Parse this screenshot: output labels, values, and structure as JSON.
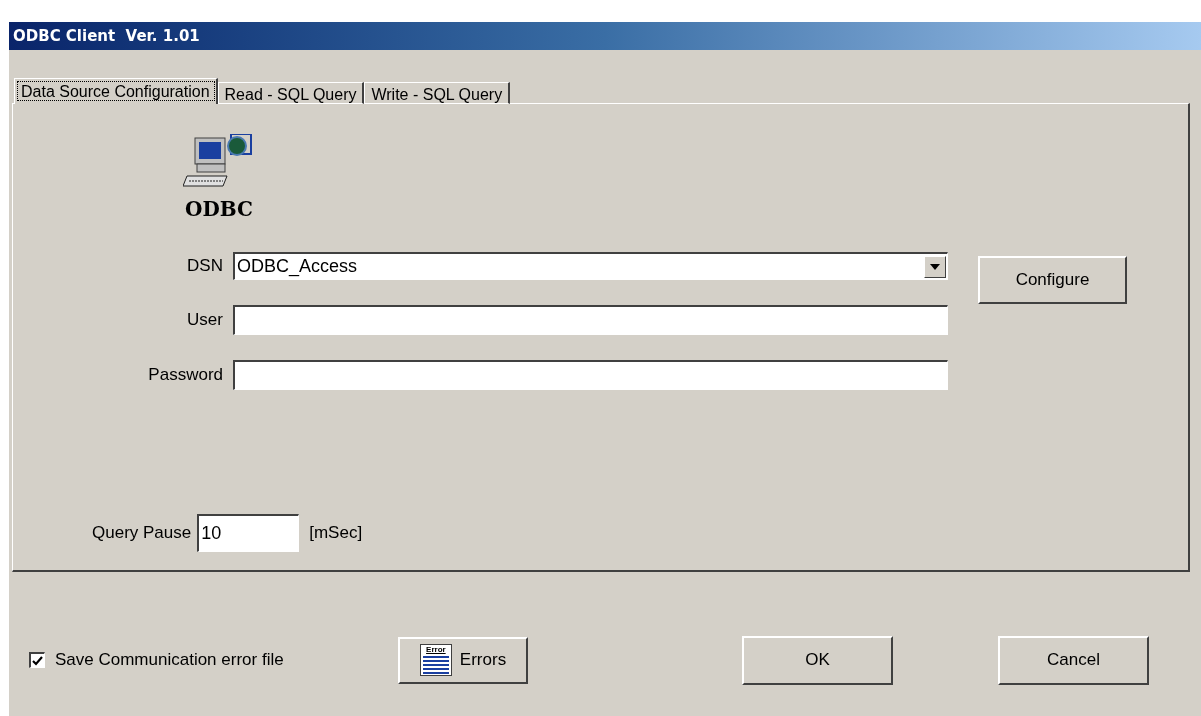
{
  "window": {
    "title": "ODBC Client  Ver. 1.01"
  },
  "tabs": [
    {
      "label": "Data Source Configuration",
      "selected": true
    },
    {
      "label": "Read - SQL Query",
      "selected": false
    },
    {
      "label": "Write - SQL Query",
      "selected": false
    }
  ],
  "logo": {
    "caption": "ODBC"
  },
  "fields": [
    {
      "kind": "dropdown",
      "label": "DSN",
      "value": "ODBC_Access"
    },
    {
      "kind": "text",
      "label": "User"
    },
    {
      "kind": "text",
      "label": "Password"
    }
  ],
  "configure_button": "Configure",
  "query_pause": {
    "label": "Query Pause",
    "value": "10",
    "unit": "[mSec]"
  },
  "save_error_file": {
    "label": "Save Communication error file",
    "checked": true
  },
  "errors_button": {
    "icon_text": "Error",
    "label": "Errors"
  },
  "buttons": [
    "OK",
    "Cancel"
  ]
}
